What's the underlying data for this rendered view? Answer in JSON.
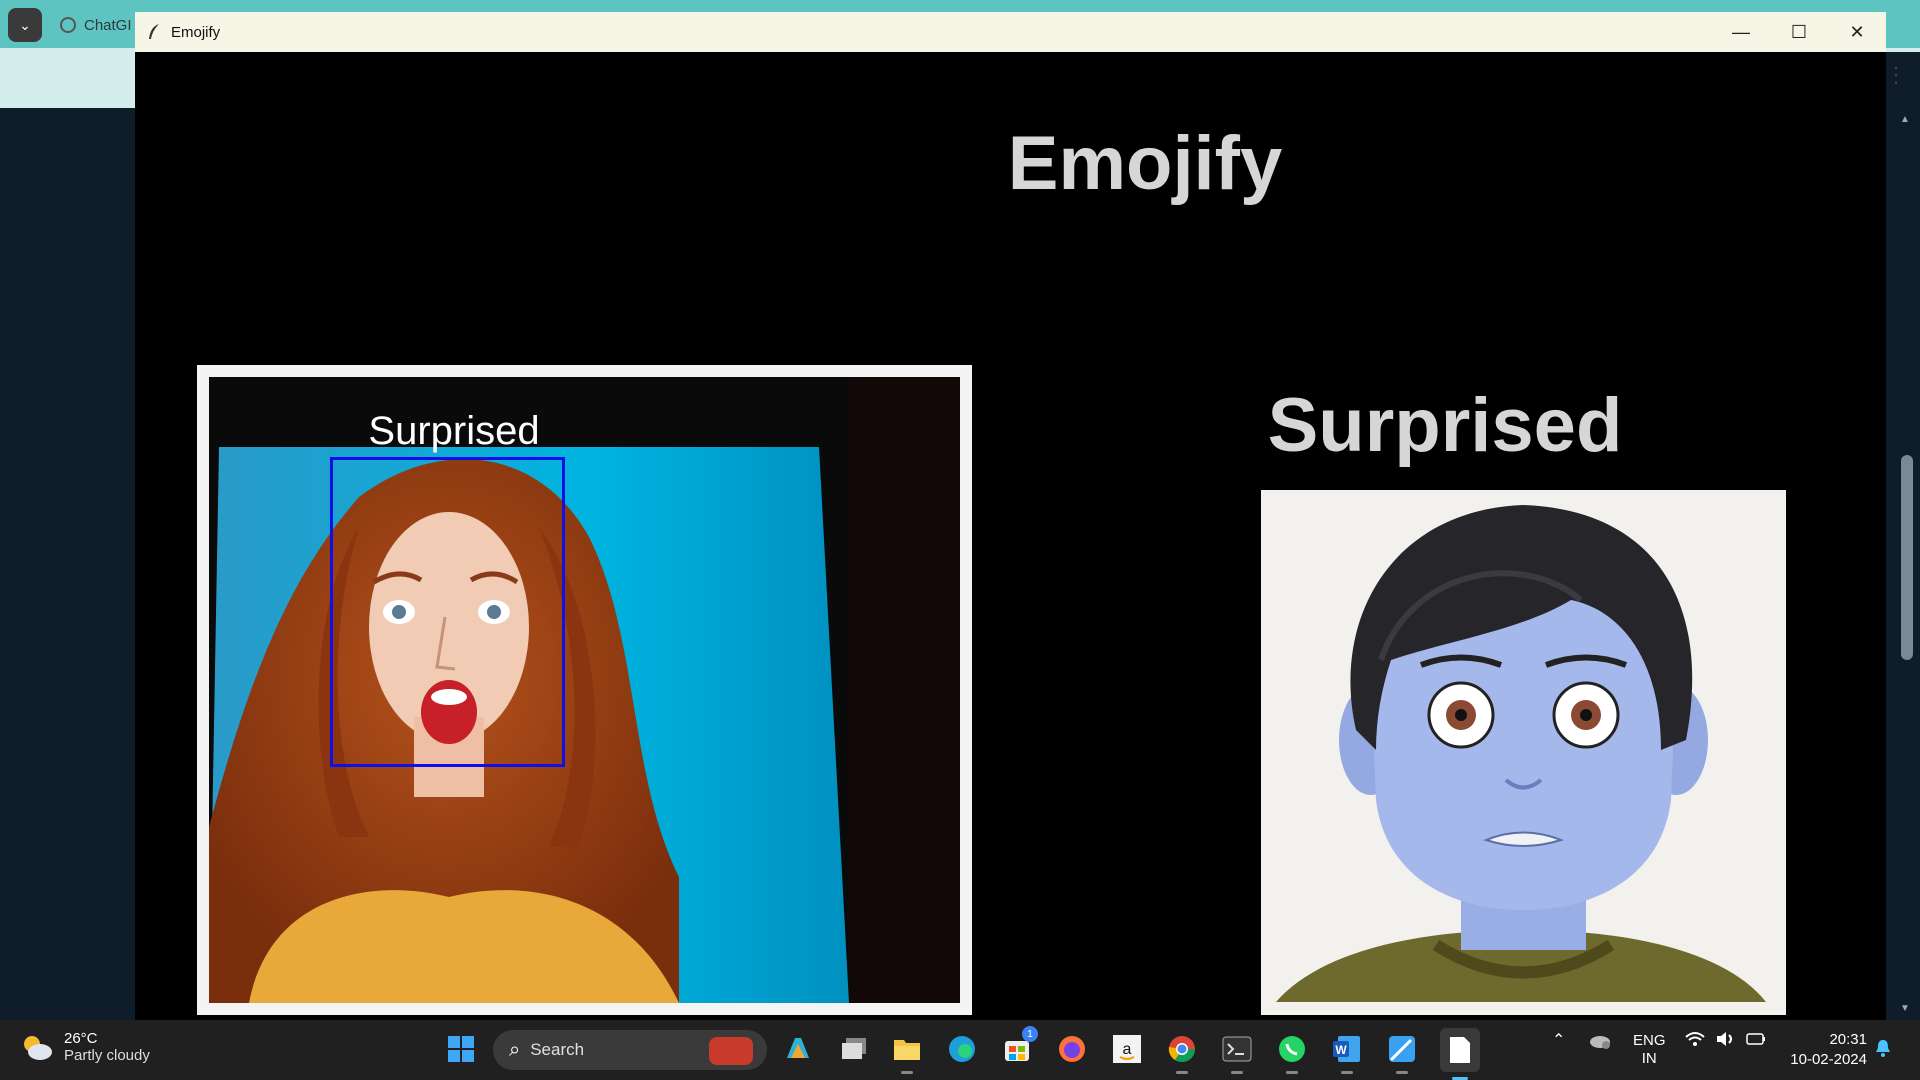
{
  "browser": {
    "tab_label": "ChatGI",
    "nav_back": "←",
    "nav_forward": "→",
    "nav_reload": "↻",
    "menu_glyph": "⋮",
    "tab_expand_glyph": "⌄"
  },
  "window": {
    "title": "Emojify",
    "minimize": "—",
    "maximize": "☐",
    "close": "✕"
  },
  "app": {
    "title": "Emojify",
    "camera_label": "Surprised",
    "emotion_label": "Surprised"
  },
  "taskbar": {
    "weather_temp": "26°C",
    "weather_desc": "Partly cloudy",
    "search_placeholder": "Search",
    "store_badge": "1",
    "lang_top": "ENG",
    "lang_bottom": "IN",
    "time": "20:31",
    "date": "10-02-2024"
  },
  "colors": {
    "face_box": "#1010e6",
    "window_bg": "#000000",
    "title_text": "#d6d6d6",
    "taskbar_bg": "#202020"
  },
  "icons": [
    "windows-start-icon",
    "search-icon",
    "copilot-icon",
    "task-view-icon",
    "file-explorer-icon",
    "edge-icon",
    "store-icon",
    "firefox-icon",
    "amazon-icon",
    "chrome-icon",
    "terminal-icon",
    "whatsapp-icon",
    "word-icon",
    "photos-icon",
    "notepad-icon"
  ]
}
